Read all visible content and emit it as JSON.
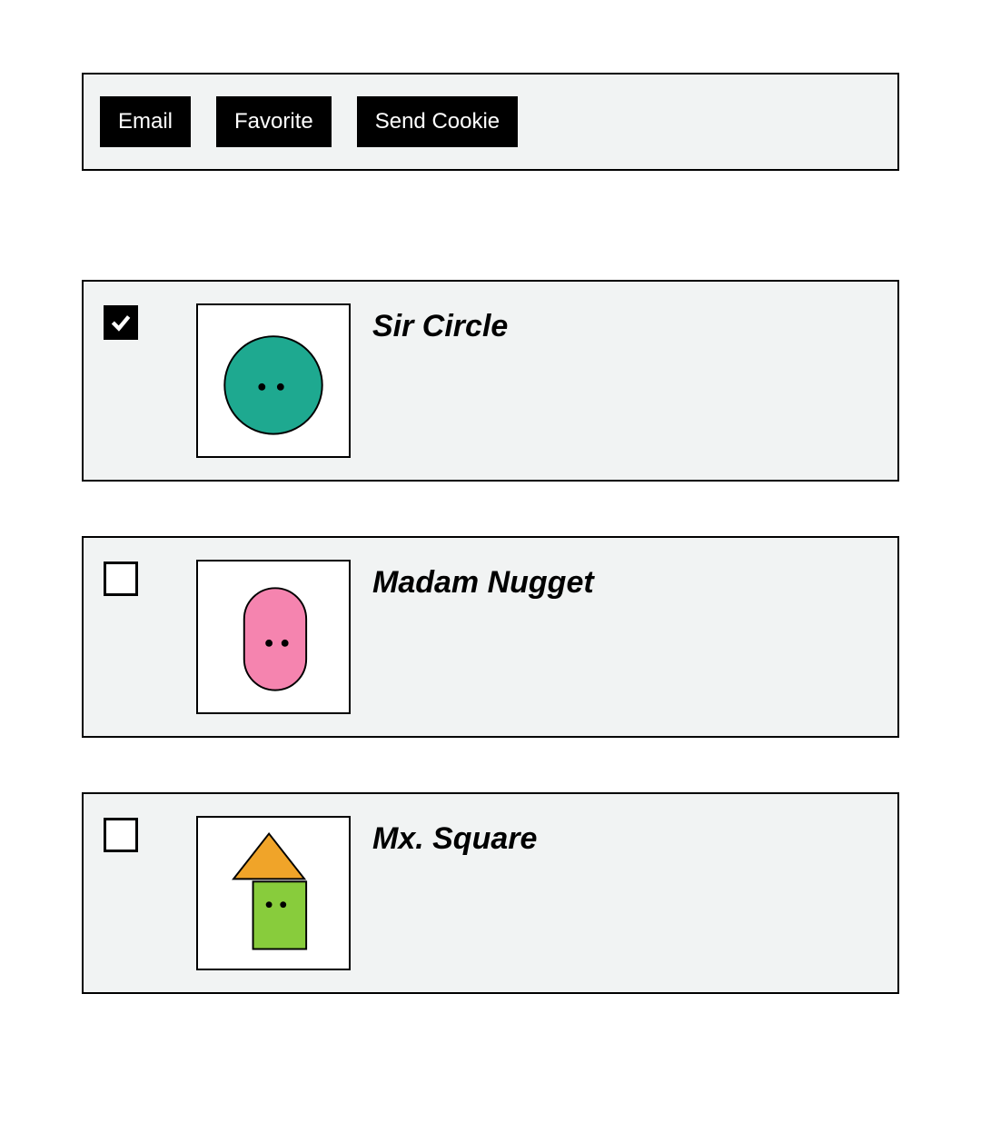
{
  "toolbar": {
    "email_label": "Email",
    "favorite_label": "Favorite",
    "send_cookie_label": "Send Cookie"
  },
  "items": [
    {
      "name": "Sir Circle",
      "checked": true,
      "avatar_kind": "circle",
      "avatar_color": "#1ea990"
    },
    {
      "name": "Madam Nugget",
      "checked": false,
      "avatar_kind": "nugget",
      "avatar_color": "#f584af"
    },
    {
      "name": "Mx. Square",
      "checked": false,
      "avatar_kind": "square",
      "avatar_color": "#88cc3c",
      "avatar_hat_color": "#f0a429"
    }
  ]
}
